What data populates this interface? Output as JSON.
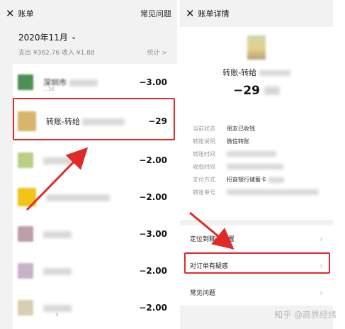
{
  "left": {
    "header": {
      "title": "账单",
      "right": "常见问题"
    },
    "month": "2020年11月",
    "summary": "支出 ¥362.76 收入 ¥1.88",
    "stats": "统计 >",
    "rows": [
      {
        "title": "深圳市",
        "sub": "…36",
        "amount": "−3.00",
        "icon_color": "#4d8f53"
      },
      {
        "title": "转账-转给",
        "sub": "",
        "amount": "−29",
        "icon_color": "#d9b46b"
      },
      {
        "title": "",
        "sub": "",
        "amount": "−2.00",
        "icon_color": "#b9cf86"
      },
      {
        "title": "",
        "sub": "",
        "amount": "−2.00",
        "icon_color": "#f0c419"
      },
      {
        "title": "",
        "sub": "",
        "amount": "−3.00",
        "icon_color": "#bca0a8"
      },
      {
        "title": "",
        "sub": "",
        "amount": "−2.00",
        "icon_color": "#c8b2c8"
      },
      {
        "title": "",
        "sub": "3",
        "amount": "−2.00",
        "icon_color": "#d7d0b0"
      }
    ]
  },
  "right": {
    "header": {
      "title": "账单详情"
    },
    "transfer_title": "转账-转给",
    "amount": "−29",
    "fields": [
      {
        "label": "当前状态",
        "value": "朋友已收钱"
      },
      {
        "label": "转账说明",
        "value": "微信转账"
      },
      {
        "label": "转账时间",
        "value": ""
      },
      {
        "label": "收款时间",
        "value": ""
      },
      {
        "label": "支付方式",
        "value": "招商银行储蓄卡"
      },
      {
        "label": "转账单号",
        "value": ""
      }
    ],
    "menu": [
      {
        "label": "定位到聊天位置"
      },
      {
        "label": "对订单有疑惑"
      },
      {
        "label": "常见问题"
      }
    ],
    "watermark": "知乎 @商界经纬"
  },
  "colors": {
    "highlight": "#e02a2a",
    "background": "#f2f2f2"
  }
}
